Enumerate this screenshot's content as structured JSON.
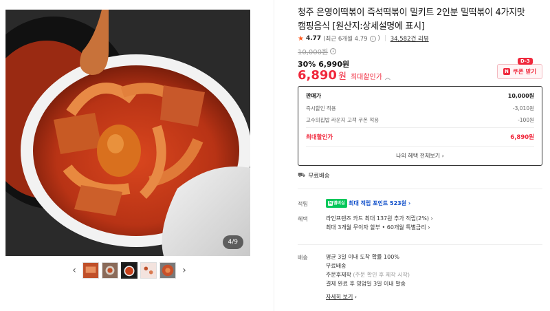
{
  "gallery": {
    "counter": "4/9",
    "thumb_count": 5,
    "active_thumb_index": 2,
    "prev_arrow": "‹",
    "next_arrow": "›"
  },
  "product": {
    "title": "청주 은영이떡볶이 즉석떡볶이 밀키트 2인분 밀떡볶이 4가지맛 캠핑음식 [원산지:상세설명에 표시]",
    "rating": "4.77",
    "rating_recent": "(최근 6개월 4.79",
    "rating_recent_close": ")",
    "review_count": "34,582건 리뷰"
  },
  "pricing": {
    "original_price": "10,000원",
    "discount_rate": "30%",
    "discount_price": "6,990원",
    "final_price": "6,890",
    "final_won": "원",
    "final_label": "최대할인가",
    "coupon": {
      "dday": "D-3",
      "label": "쿠폰 받기",
      "icon": "N"
    }
  },
  "price_box": {
    "rows": [
      {
        "label": "판매가",
        "value": "10,000원"
      },
      {
        "label": "즉시할인 적용",
        "value": "-3,010원"
      },
      {
        "label": "고수의집밥 라운지 고객 쿠폰 적용",
        "value": "-100원"
      }
    ],
    "max_label": "최대할인가",
    "max_value": "6,890원",
    "all_benefits": "나의 혜택 전체보기"
  },
  "shipping": {
    "label": "무료배송"
  },
  "points": {
    "label": "적립",
    "badge": "멤버십",
    "text": "최대 적립 포인트 523원"
  },
  "benefits": {
    "label": "혜택",
    "line1": "라인프렌즈 카드 최대 137원 추가 적립(2%)",
    "line2": "최대 3개월 무이자 할부 • 60개월 특별금리"
  },
  "delivery": {
    "label": "배송",
    "line1": "평균 3일 이내 도착 확률 100%",
    "line2": "무료배송",
    "line3_main": "주문후제작",
    "line3_note": "(주문 확인 후 제작 시작)",
    "line4": "결제 완료 후 영업일 3일 이내 발송",
    "detail_link": "자세히 보기"
  },
  "colors": {
    "accent_red": "#f0283c",
    "star": "#ff5a1f",
    "naver_green": "#03c75a",
    "link_blue": "#0c4cc9"
  },
  "icons": [
    "star-icon",
    "info-icon",
    "caret-up-icon",
    "coupon-n-icon",
    "truck-icon",
    "chevron-right-icon",
    "chevron-left-icon"
  ]
}
